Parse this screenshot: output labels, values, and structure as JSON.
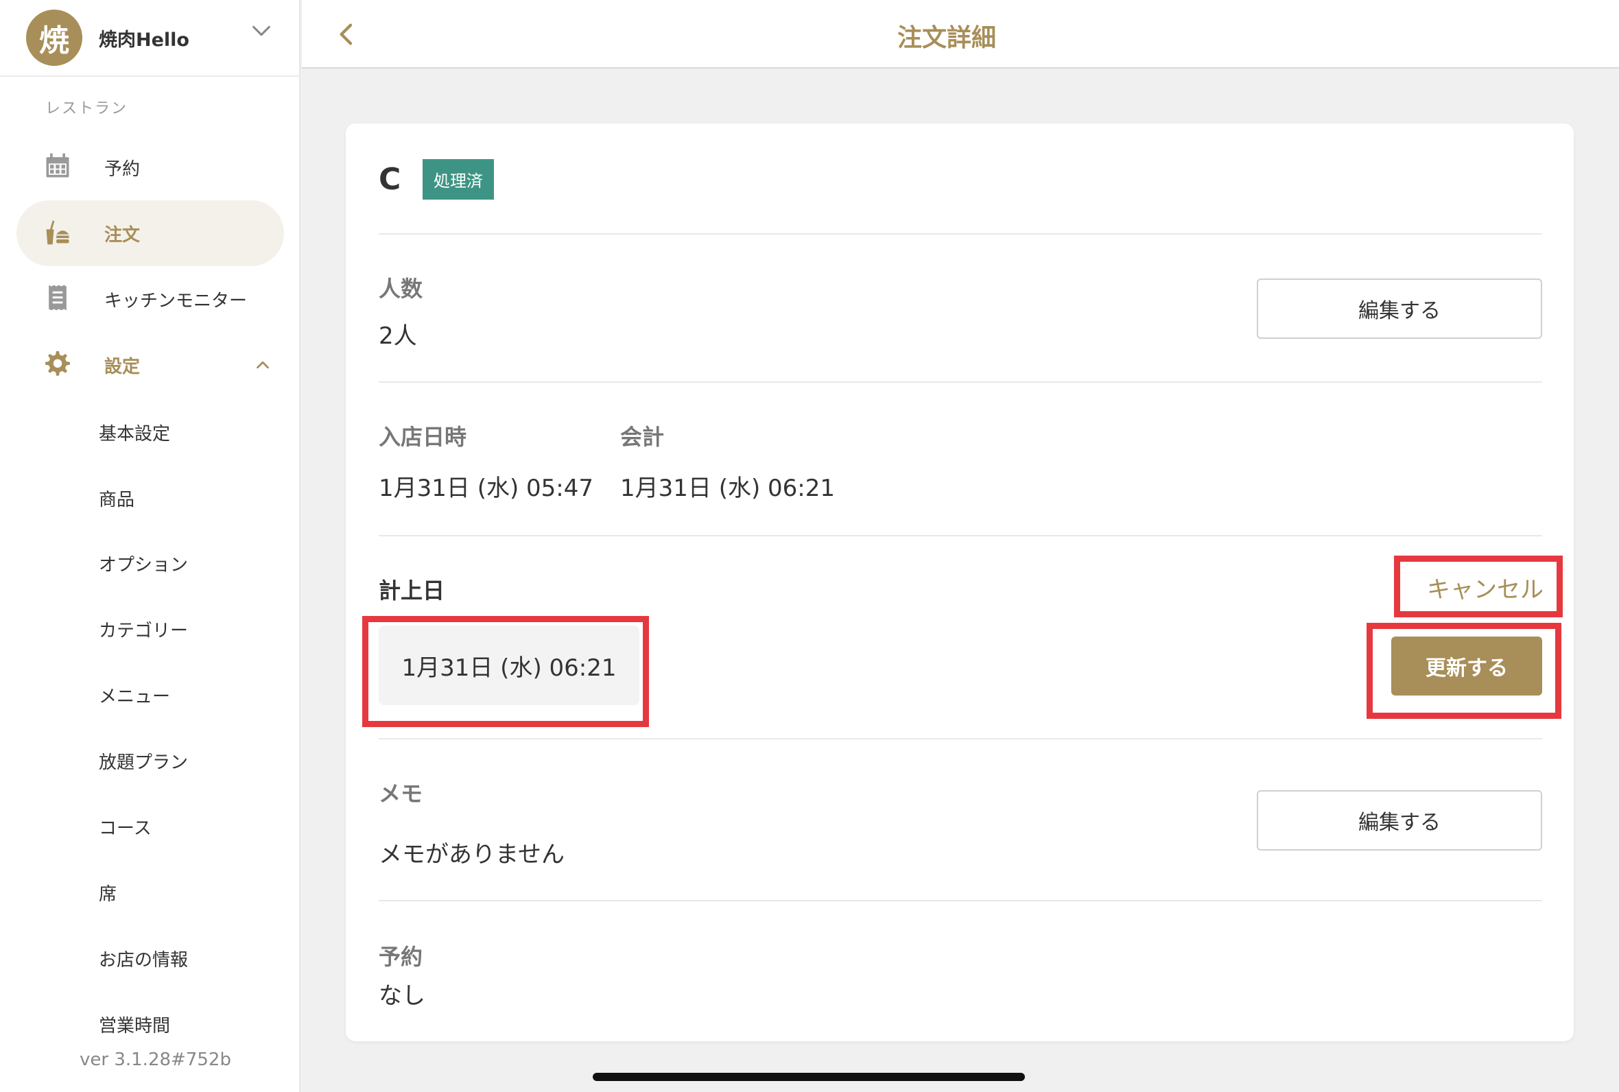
{
  "store": {
    "logo_char": "焼",
    "name": "焼肉Hello"
  },
  "sidebar": {
    "section_label": "レストラン",
    "items": [
      {
        "label": "予約",
        "icon": "calendar-icon"
      },
      {
        "label": "注文",
        "icon": "order-tray-icon",
        "active": true
      },
      {
        "label": "キッチンモニター",
        "icon": "receipt-icon"
      },
      {
        "label": "設定",
        "icon": "gear-icon",
        "expanded": true
      }
    ],
    "sub_items": [
      "基本設定",
      "商品",
      "オプション",
      "カテゴリー",
      "メニュー",
      "放題プラン",
      "コース",
      "席",
      "お店の情報",
      "営業時間"
    ],
    "version": "ver 3.1.28#752b"
  },
  "header": {
    "title": "注文詳細"
  },
  "order": {
    "id": "C",
    "status": "処理済",
    "people_label": "人数",
    "people_value": "2人",
    "edit_label": "編集する",
    "entry_label": "入店日時",
    "entry_value": "1月31日 (水) 05:47",
    "checkout_label": "会計",
    "checkout_value": "1月31日 (水) 06:21",
    "booking_date_label": "計上日",
    "booking_date_value": "1月31日 (水) 06:21",
    "cancel_label": "キャンセル",
    "update_label": "更新する",
    "memo_label": "メモ",
    "memo_value": "メモがありません",
    "memo_edit_label": "編集する",
    "reservation_label": "予約",
    "reservation_value": "なし"
  },
  "colors": {
    "accent": "#a88e58",
    "status": "#3e9484",
    "highlight": "#e5393f"
  }
}
